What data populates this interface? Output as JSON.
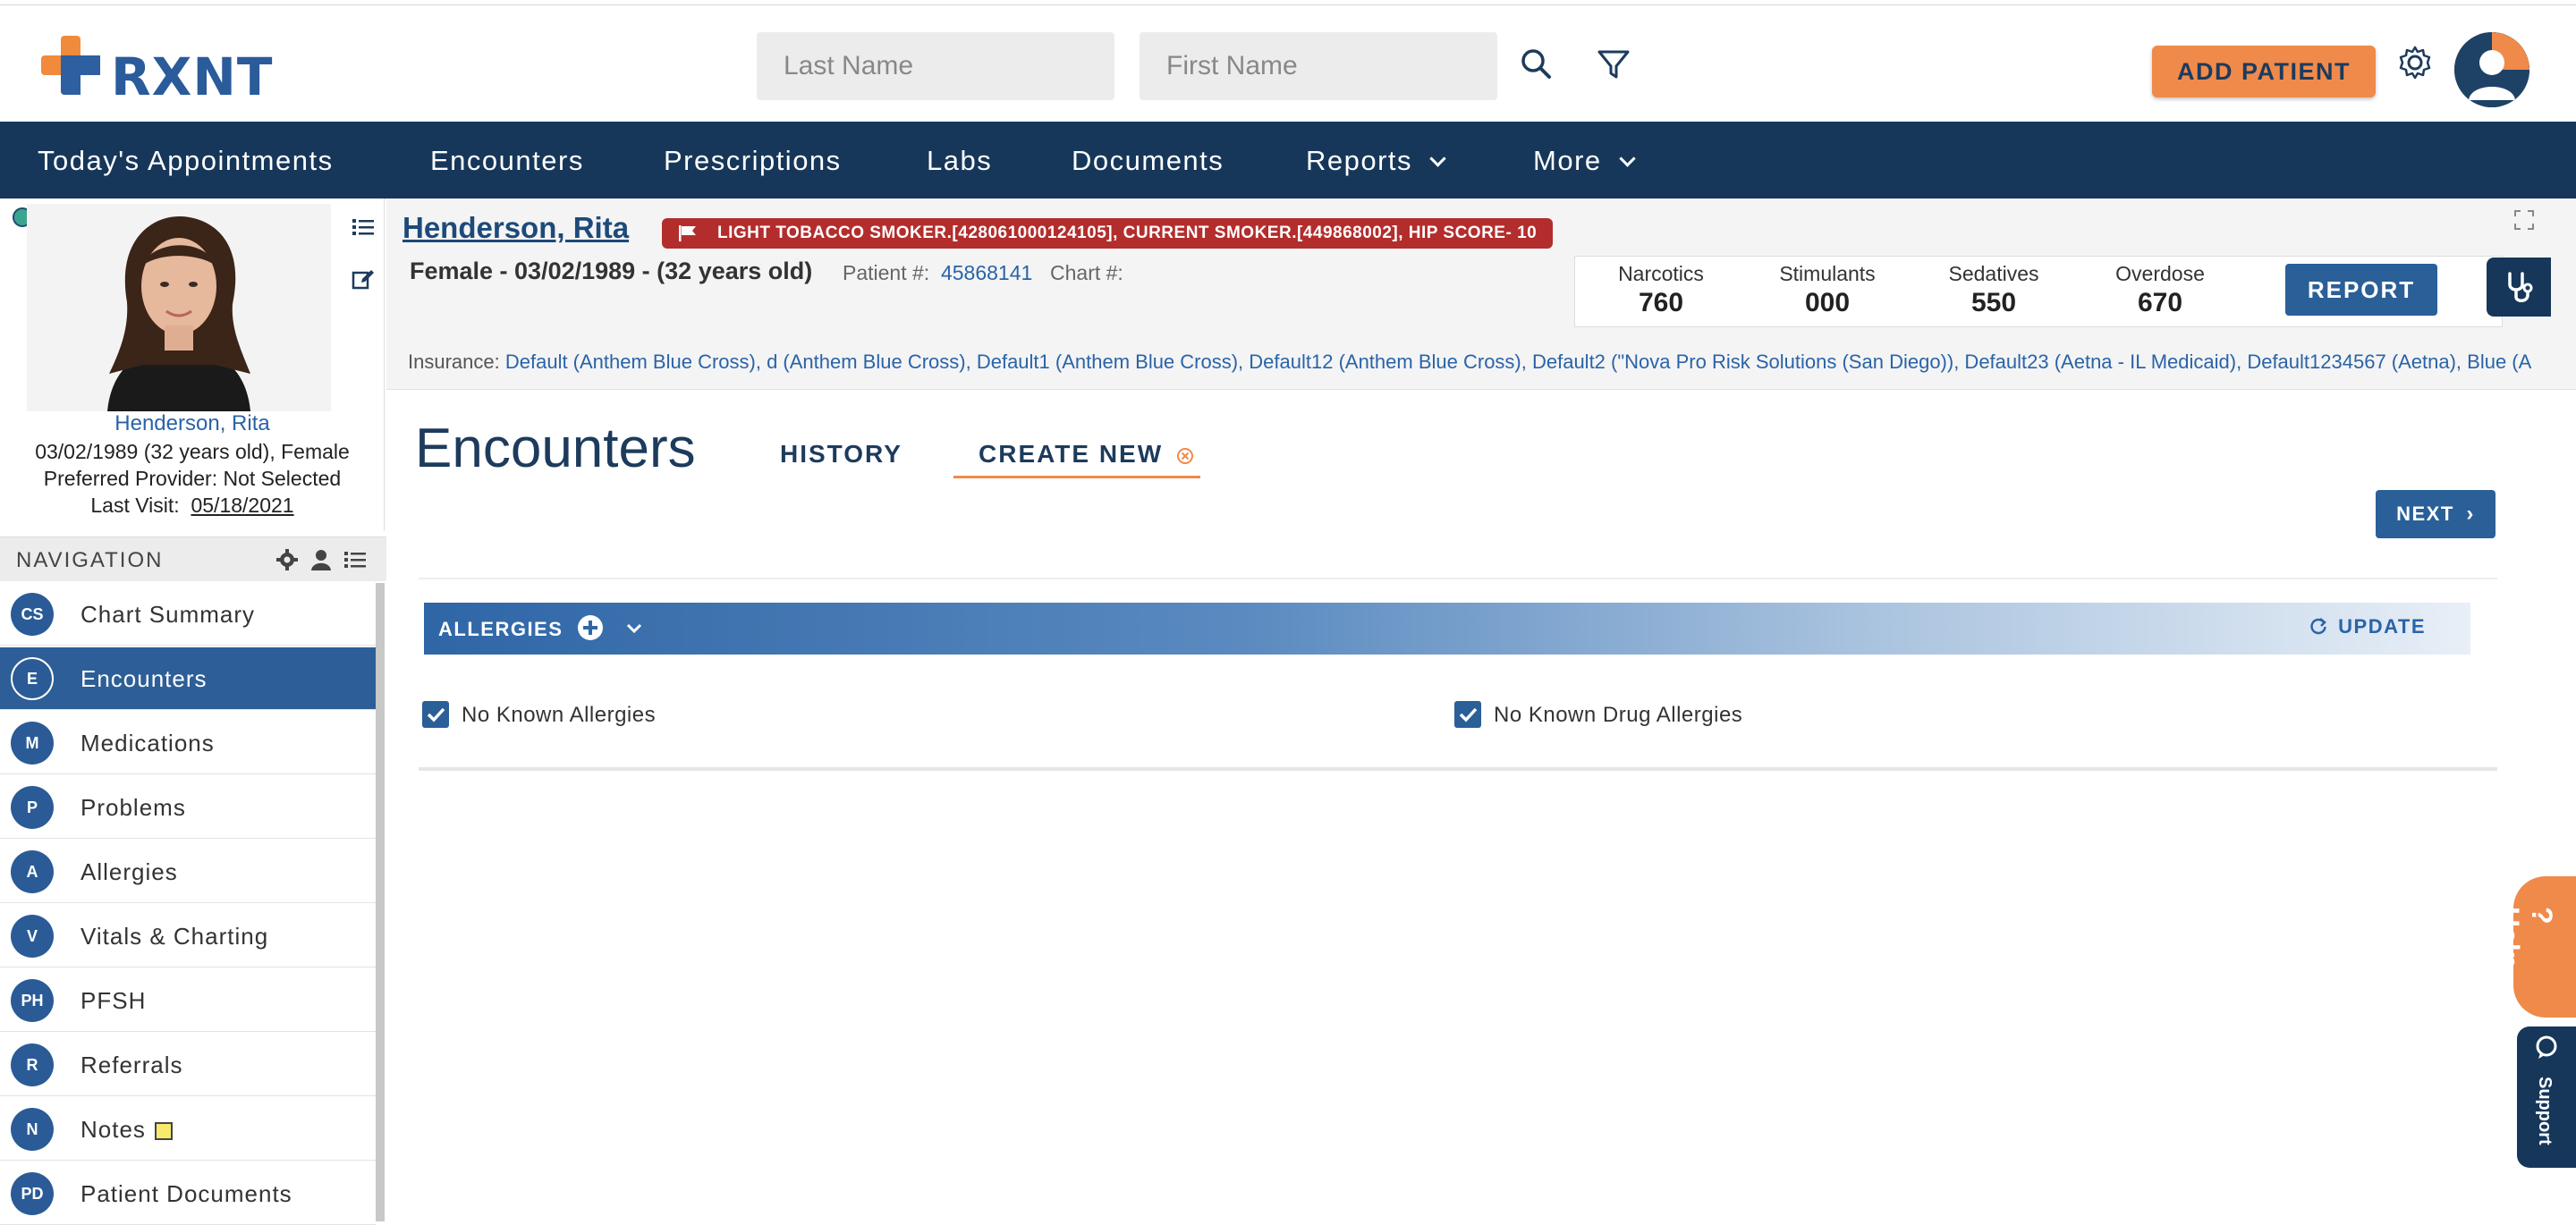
{
  "brand": {
    "name": "RXNT",
    "accent": "#f08a4b",
    "primary": "#16375a"
  },
  "search": {
    "last_name_placeholder": "Last Name",
    "first_name_placeholder": "First Name"
  },
  "header": {
    "add_patient": "ADD PATIENT"
  },
  "topnav": [
    {
      "label": "Today's Appointments"
    },
    {
      "label": "Encounters"
    },
    {
      "label": "Prescriptions"
    },
    {
      "label": "Labs"
    },
    {
      "label": "Documents"
    },
    {
      "label": "Reports"
    },
    {
      "label": "More"
    }
  ],
  "patient_card": {
    "name": "Henderson, Rita",
    "dob_sex": "03/02/1989 (32 years old), Female",
    "provider": "Preferred Provider: Not Selected",
    "last_visit_label": "Last Visit:",
    "last_visit": "05/18/2021"
  },
  "navigation": {
    "title": "NAVIGATION",
    "items": [
      {
        "abbr": "CS",
        "label": "Chart Summary"
      },
      {
        "abbr": "E",
        "label": "Encounters"
      },
      {
        "abbr": "M",
        "label": "Medications"
      },
      {
        "abbr": "P",
        "label": "Problems"
      },
      {
        "abbr": "A",
        "label": "Allergies"
      },
      {
        "abbr": "V",
        "label": "Vitals & Charting"
      },
      {
        "abbr": "PH",
        "label": "PFSH"
      },
      {
        "abbr": "R",
        "label": "Referrals"
      },
      {
        "abbr": "N",
        "label": "Notes"
      },
      {
        "abbr": "PD",
        "label": "Patient Documents"
      }
    ],
    "active": "Encounters"
  },
  "patient_header": {
    "name": "Henderson, Rita",
    "alert": "LIGHT TOBACCO SMOKER.[428061000124105], CURRENT SMOKER.[449868002], HIP SCORE- 10",
    "demographics": "Female - 03/02/1989 - (32 years old)",
    "patient_no_label": "Patient #:",
    "patient_no": "45868141",
    "chart_no_label": "Chart #:",
    "insurance_label": "Insurance:",
    "insurance": "Default (Anthem Blue Cross), d (Anthem Blue Cross), Default1 (Anthem Blue Cross), Default12 (Anthem Blue Cross), Default2 (\"Nova Pro Risk Solutions (San Diego)), Default23 (Aetna - IL Medicaid), Default1234567 (Aetna), Blue (A"
  },
  "pdmp": {
    "narcotics_label": "Narcotics",
    "narcotics": "760",
    "stimulants_label": "Stimulants",
    "stimulants": "000",
    "sedatives_label": "Sedatives",
    "sedatives": "550",
    "overdose_label": "Overdose",
    "overdose": "670",
    "report": "REPORT"
  },
  "encounters": {
    "title": "Encounters",
    "tab_history": "HISTORY",
    "tab_create": "CREATE NEW",
    "next": "NEXT",
    "allergies_label": "ALLERGIES",
    "update": "UPDATE",
    "no_known_allergies": "No Known Allergies",
    "no_known_allergies_checked": true,
    "no_known_drug_allergies": "No Known Drug Allergies",
    "no_known_drug_allergies_checked": true
  },
  "side_tabs": {
    "help": "Help",
    "support": "Support"
  }
}
